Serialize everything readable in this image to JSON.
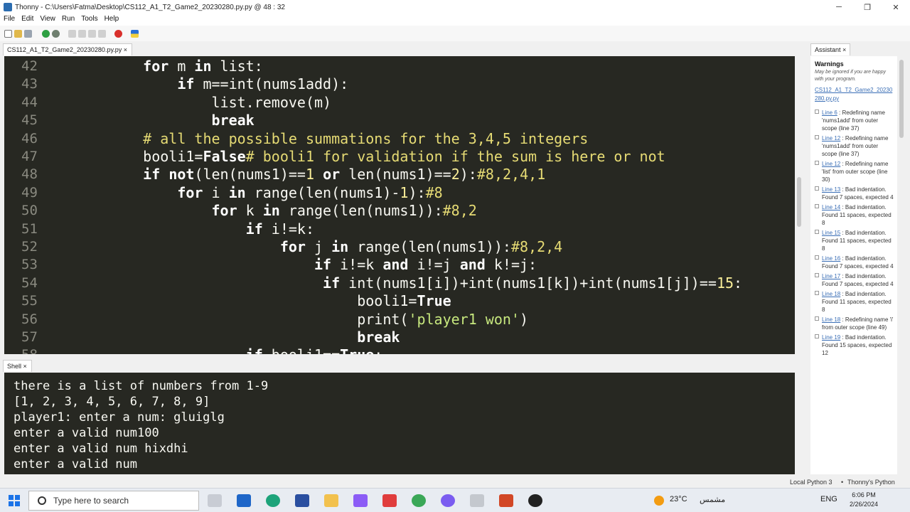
{
  "window": {
    "title": "Thonny  -  C:\\Users\\Fatma\\Desktop\\CS112_A1_T2_Game2_20230280.py.py  @  48 : 32",
    "minimize": "─",
    "maximize": "❐",
    "close": "✕"
  },
  "menu": [
    "File",
    "Edit",
    "View",
    "Run",
    "Tools",
    "Help"
  ],
  "editor": {
    "tab_label": "CS112_A1_T2_Game2_20230280.py.py ×",
    "lines": [
      {
        "n": "42",
        "html": "    <span class=\"kw\">for</span> m <span class=\"kw\">in</span> list:"
      },
      {
        "n": "43",
        "html": "        <span class=\"kw\">if</span> m==int(nums1add):"
      },
      {
        "n": "44",
        "html": "            list.remove(m)"
      },
      {
        "n": "45",
        "html": "            <span class=\"kw\">break</span>"
      },
      {
        "n": "46",
        "html": "    <span class=\"cm\"># all the possible summations for the 3,4,5 integers</span>"
      },
      {
        "n": "47",
        "html": "    booli1=<span class=\"kw\">False</span><span class=\"cm\"># booli1 for validation if the sum is here or not</span>"
      },
      {
        "n": "48",
        "html": "    <span class=\"kw\">if</span> <span class=\"kw\">not</span>(len(nums1)==<span class=\"num\">1</span> <span class=\"kw\">or</span> len(nums1)==<span class=\"num\">2</span>):<span class=\"cm\">#8,2,4,1</span>"
      },
      {
        "n": "49",
        "html": "        <span class=\"kw\">for</span> i <span class=\"kw\">in</span> range(len(nums1)-<span class=\"num\">1</span>):<span class=\"cm\">#8</span>"
      },
      {
        "n": "50",
        "html": "            <span class=\"kw\">for</span> k <span class=\"kw\">in</span> range(len(nums1)):<span class=\"cm\">#8,2</span>"
      },
      {
        "n": "51",
        "html": "                <span class=\"kw\">if</span> i!=k:"
      },
      {
        "n": "52",
        "html": "                    <span class=\"kw\">for</span> j <span class=\"kw\">in</span> range(len(nums1)):<span class=\"cm\">#8,2,4</span>"
      },
      {
        "n": "53",
        "html": "                        <span class=\"kw\">if</span> i!=k <span class=\"kw\">and</span> i!=j <span class=\"kw\">and</span> k!=j:"
      },
      {
        "n": "54",
        "html": "                         <span class=\"kw\">if</span> int(nums1[i])+int(nums1[k])+int(nums1[j])==<span class=\"num\">15</span>:"
      },
      {
        "n": "55",
        "html": "                             booli1=<span class=\"kw\">True</span>"
      },
      {
        "n": "56",
        "html": "                             print(<span class=\"str\">'player1 won'</span>)"
      },
      {
        "n": "57",
        "html": "                             <span class=\"kw\">break</span>"
      },
      {
        "n": "58",
        "html": "                <span class=\"kw\">if</span> booli1==<span class=\"kw\">True</span>:"
      }
    ]
  },
  "shell": {
    "tab_label": "Shell ×",
    "lines": [
      "there is a list of numbers from 1-9",
      "[1, 2, 3, 4, 5, 6, 7, 8, 9]",
      "player1: enter a num: gluiglg",
      "enter a valid num100",
      "enter a valid num hixdhi",
      "enter a valid num"
    ]
  },
  "assistant": {
    "tab_label": "Assistant ×",
    "heading": "Warnings",
    "subtitle": "May be ignored if you are happy with your program.",
    "file_link": "CS112_A1_T2_Game2_20230280.py.py",
    "warnings": [
      {
        "line": "Line 6",
        "text": " : Redefining name 'nums1add' from outer scope (line 37)"
      },
      {
        "line": "Line 12",
        "text": " : Redefining name 'nums1add' from outer scope (line 37)"
      },
      {
        "line": "Line 12",
        "text": " : Redefining name 'list' from outer scope (line 30)"
      },
      {
        "line": "Line 13",
        "text": " : Bad indentation. Found 7 spaces, expected 4"
      },
      {
        "line": "Line 14",
        "text": " : Bad indentation. Found 11 spaces, expected 8"
      },
      {
        "line": "Line 15",
        "text": " : Bad indentation. Found 11 spaces, expected 8"
      },
      {
        "line": "Line 16",
        "text": " : Bad indentation. Found 7 spaces, expected 4"
      },
      {
        "line": "Line 17",
        "text": " : Bad indentation. Found 7 spaces, expected 4"
      },
      {
        "line": "Line 18",
        "text": " : Bad indentation. Found 11 spaces, expected 8"
      },
      {
        "line": "Line 18",
        "text": " : Redefining name 'i' from outer scope (line 49)"
      },
      {
        "line": "Line 19",
        "text": " : Bad indentation. Found 15 spaces, expected 12"
      }
    ]
  },
  "statusbar": {
    "interpreter": "Local Python 3",
    "separator": "•",
    "python_label": "Thonny's Python"
  },
  "taskbar": {
    "search_placeholder": "Type here to search",
    "temperature": "23°C",
    "weather_text": "مشمس",
    "language": "ENG",
    "time": "6:06 PM",
    "date": "2/26/2024",
    "colors": {
      "accent": "#1a73e8",
      "editor_bg": "#272822"
    }
  }
}
